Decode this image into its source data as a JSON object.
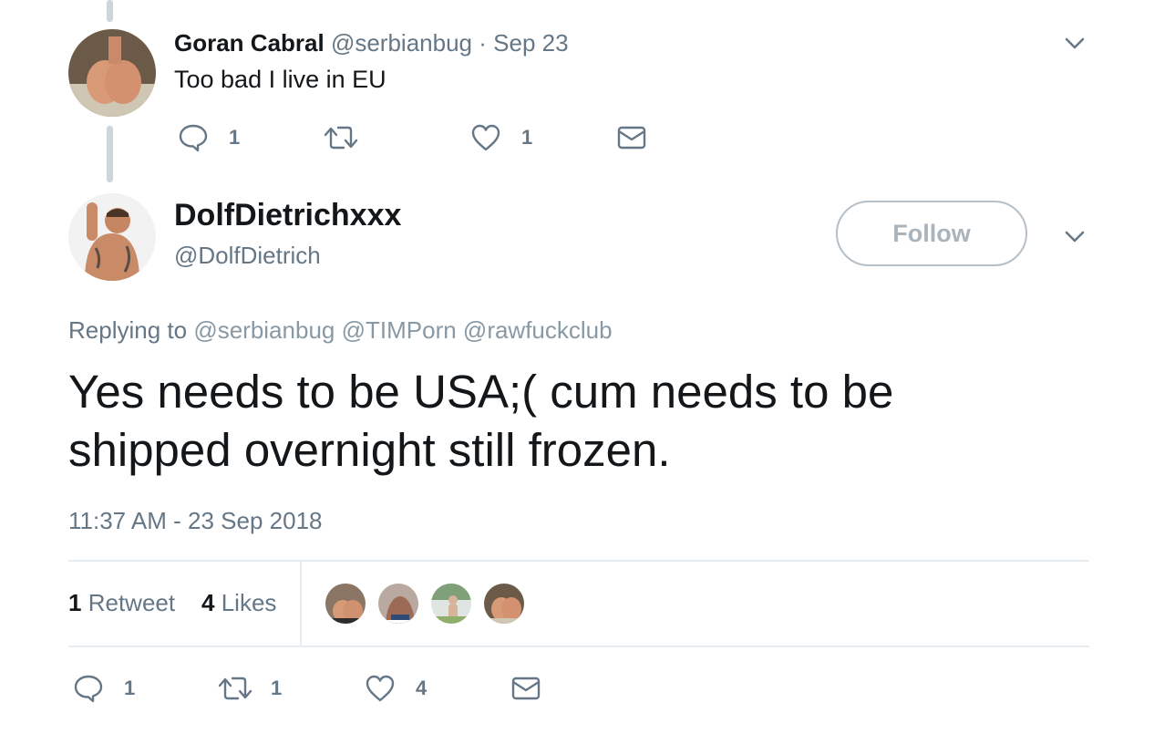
{
  "reply_tweet": {
    "display_name": "Goran Cabral",
    "handle": "@serbianbug",
    "separator": "·",
    "date": "Sep 23",
    "text": "Too bad I live in EU",
    "reply_count": "1",
    "retweet_count": "",
    "like_count": "1"
  },
  "main_tweet": {
    "display_name": "DolfDietrichxxx",
    "handle": "@DolfDietrich",
    "follow_label": "Follow",
    "replying_prefix": "Replying to",
    "replying_handles": [
      "@serbianbug",
      "@TIMPorn",
      "@rawfuckclub"
    ],
    "text_line1": "Yes needs to be USA;( cum needs to be",
    "text_line2": "shipped overnight still frozen.",
    "timestamp": "11:37 AM - 23 Sep 2018",
    "stats": {
      "retweet_number": "1",
      "retweet_label": "Retweet",
      "like_number": "4",
      "like_label": "Likes"
    },
    "actions": {
      "reply_count": "1",
      "retweet_count": "1",
      "like_count": "4"
    }
  },
  "colors": {
    "text": "#14171a",
    "secondary": "#657786",
    "muted_link": "#8899a6",
    "border": "#e6ecf0",
    "thread_line": "#ccd6dd"
  },
  "icons": [
    "chevron-down-icon",
    "reply-icon",
    "retweet-icon",
    "heart-icon",
    "envelope-icon"
  ]
}
